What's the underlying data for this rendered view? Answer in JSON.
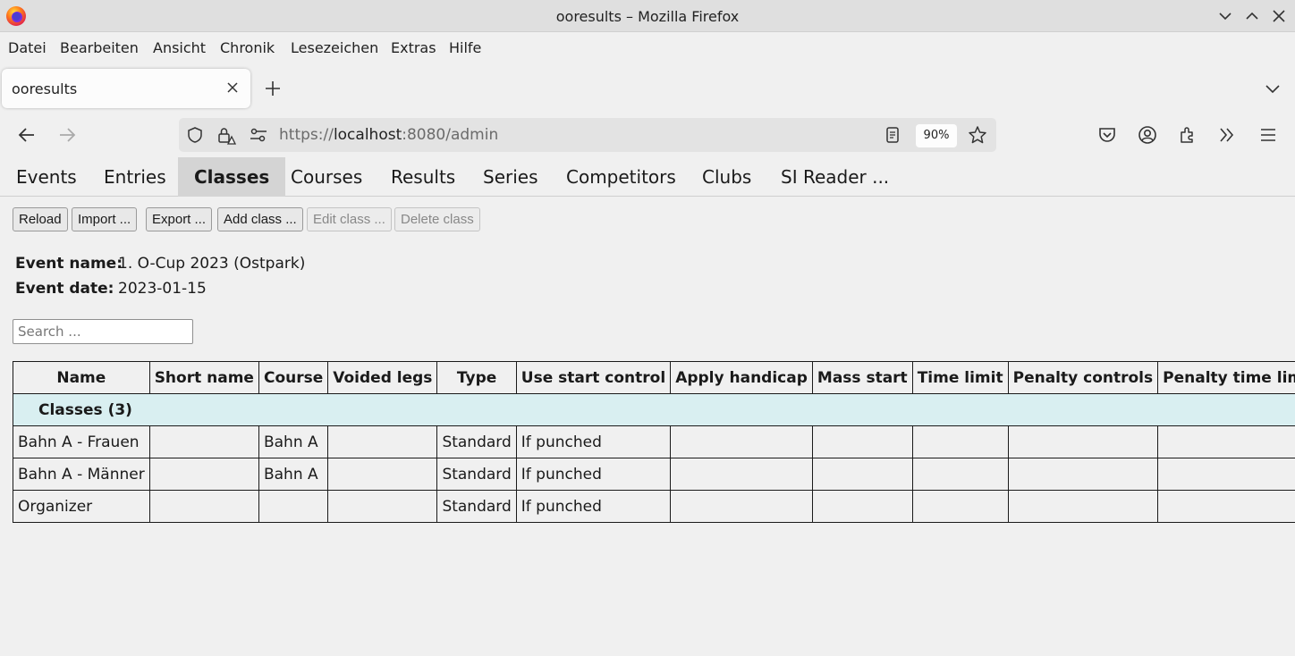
{
  "window": {
    "title": "ooresults – Mozilla Firefox"
  },
  "menu": [
    "Datei",
    "Bearbeiten",
    "Ansicht",
    "Chronik",
    "Lesezeichen",
    "Extras",
    "Hilfe"
  ],
  "browser_tab": {
    "label": "ooresults"
  },
  "urlbar": {
    "scheme": "https://",
    "host": "localhost",
    "path": ":8080/admin",
    "zoom": "90%"
  },
  "app_tabs": [
    "Events",
    "Entries",
    "Classes",
    "Courses",
    "Results",
    "Series",
    "Competitors",
    "Clubs",
    "SI Reader ..."
  ],
  "active_tab": "Classes",
  "toolbar": {
    "reload": "Reload",
    "import": "Import ...",
    "export": "Export ...",
    "add": "Add class ...",
    "edit": "Edit class ...",
    "delete": "Delete class"
  },
  "event": {
    "name_label": "Event name:",
    "name": "1. O-Cup 2023 (Ostpark)",
    "date_label": "Event date:",
    "date": "2023-01-15"
  },
  "search": {
    "placeholder": "Search ..."
  },
  "table": {
    "headers": [
      "Name",
      "Short name",
      "Course",
      "Voided legs",
      "Type",
      "Use start control",
      "Apply handicap",
      "Mass start",
      "Time limit",
      "Penalty controls",
      "Penalty time limit"
    ],
    "group_label": "Classes  (3)",
    "rows": [
      [
        "Bahn A - Frauen",
        "",
        "Bahn A",
        "",
        "Standard",
        "If punched",
        "",
        "",
        "",
        "",
        ""
      ],
      [
        "Bahn A - Männer",
        "",
        "Bahn A",
        "",
        "Standard",
        "If punched",
        "",
        "",
        "",
        "",
        ""
      ],
      [
        "Organizer",
        "",
        "",
        "",
        "Standard",
        "If punched",
        "",
        "",
        "",
        "",
        ""
      ]
    ]
  }
}
